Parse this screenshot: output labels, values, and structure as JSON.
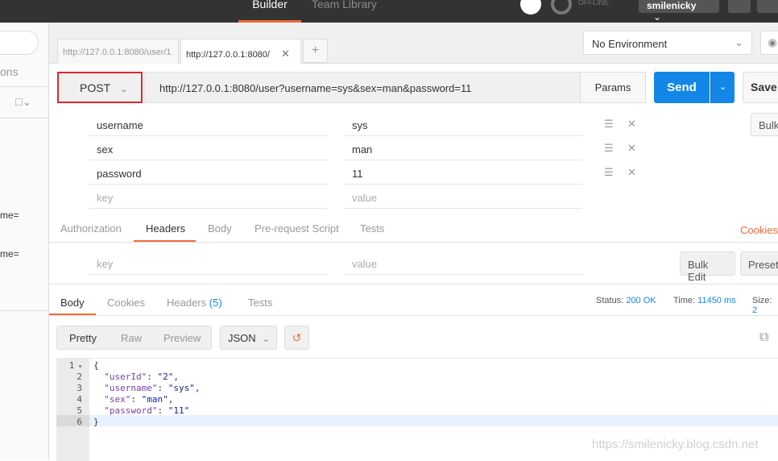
{
  "topbar": {
    "builder_tab": "Builder",
    "team_library_tab": "Team Library",
    "offline_label": "OFFLINE",
    "username": "smilenicky"
  },
  "sidebar": {
    "collections_fragment": "ons",
    "history_fragments": [
      "me=",
      "me="
    ]
  },
  "request_tabs": [
    {
      "label": "http://127.0.0.1:8080/user/1"
    },
    {
      "label": "http://127.0.0.1:8080/"
    }
  ],
  "environment": {
    "selected": "No Environment"
  },
  "request": {
    "method": "POST",
    "url": "http://127.0.0.1:8080/user?username=sys&sex=man&password=11",
    "params_label": "Params",
    "send_label": "Send",
    "save_label": "Save"
  },
  "params": {
    "rows": [
      {
        "key": "username",
        "value": "sys"
      },
      {
        "key": "sex",
        "value": "man"
      },
      {
        "key": "password",
        "value": "11"
      }
    ],
    "key_placeholder": "key",
    "value_placeholder": "value",
    "bulk_label": "Bulk"
  },
  "request_subtabs": [
    "Authorization",
    "Headers",
    "Body",
    "Pre-request Script",
    "Tests"
  ],
  "cookies_link": "Cookies",
  "headers": {
    "key_placeholder": "key",
    "value_placeholder": "value",
    "bulk_edit_label": "Bulk Edit",
    "presets_label": "Presets"
  },
  "response": {
    "tabs": {
      "body": "Body",
      "cookies": "Cookies",
      "headers": "Headers",
      "headers_count": "(5)",
      "tests": "Tests"
    },
    "status_label": "Status:",
    "status_value": "200 OK",
    "time_label": "Time:",
    "time_value": "11450 ms",
    "size_label": "Size:",
    "size_value": "2",
    "format_buttons": {
      "pretty": "Pretty",
      "raw": "Raw",
      "preview": "Preview"
    },
    "format_select": "JSON",
    "code_lines": [
      {
        "n": "1",
        "text": "{"
      },
      {
        "n": "2",
        "key": "\"userId\"",
        "val": "\"2\"",
        "comma": ","
      },
      {
        "n": "3",
        "key": "\"username\"",
        "val": "\"sys\"",
        "comma": ","
      },
      {
        "n": "4",
        "key": "\"sex\"",
        "val": "\"man\"",
        "comma": ","
      },
      {
        "n": "5",
        "key": "\"password\"",
        "val": "\"11\"",
        "comma": ""
      },
      {
        "n": "6",
        "text": "}"
      }
    ]
  },
  "watermark": "https://smilenicky.blog.csdn.net",
  "colors": {
    "accent": "#f26b3a",
    "send": "#1287e8",
    "method_highlight": "#e0262e"
  }
}
